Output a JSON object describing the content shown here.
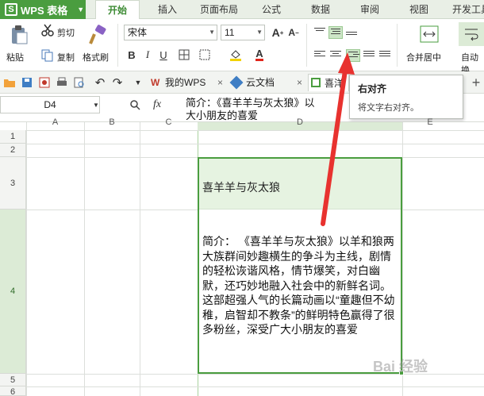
{
  "app": {
    "name": "WPS 表格"
  },
  "menu_tabs": [
    "开始",
    "插入",
    "页面布局",
    "公式",
    "数据",
    "审阅",
    "视图",
    "开发工具"
  ],
  "ribbon": {
    "paste": "粘贴",
    "cut": "剪切",
    "copy": "复制",
    "format_painter": "格式刷",
    "font_name": "宋体",
    "font_size": "11",
    "merge_center": "合并居中",
    "auto_wrap": "自动换"
  },
  "quick_tabs": [
    "我的WPS",
    "云文档",
    "喜洋"
  ],
  "name_box": "D4",
  "fx": "fx",
  "formula_text": "简介：《喜羊羊与灰太狼》以羊和狼两大族群间妙趣横生的争斗为主线，剧情的轻松诙谐风格，情节爆笑，对白幽默，还巧妙地融入社会中的新鲜名词。这部超强人气的长篇动画以“童趣但不幼稚，启智却不教条”的鲜明特色赢得了很多粉丝，深受广大小朋友的喜爱",
  "formula_visible_line1": "简介：《喜羊羊与灰太狼》以",
  "formula_visible_line1_tail": "横生",
  "formula_visible_line2": "大小朋友的喜爱",
  "tooltip": {
    "title": "右对齐",
    "desc": "将文字右对齐。"
  },
  "columns": [
    "A",
    "B",
    "C",
    "D",
    "E"
  ],
  "rows": [
    "1",
    "2",
    "3",
    "4",
    "5",
    "6"
  ],
  "cells": {
    "D3": "喜羊羊与灰太狼",
    "D4": "简介：  《喜羊羊与灰太狼》以羊和狼两大族群间妙趣横生的争斗为主线，剧情的轻松诙谐风格，情节爆笑，对白幽默，还巧妙地融入社会中的新鲜名词。这部超强人气的长篇动画以“童趣但不幼稚，启智却不教条”的鲜明特色赢得了很多粉丝，深受广大小朋友的喜爱"
  },
  "watermark": "Bai 经验",
  "colors": {
    "accent": "#4a9d3f",
    "arrow": "#e8322f"
  }
}
